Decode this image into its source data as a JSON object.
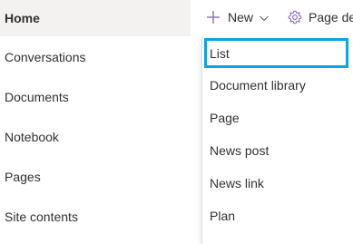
{
  "leftnav": {
    "items": [
      {
        "label": "Home"
      },
      {
        "label": "Conversations"
      },
      {
        "label": "Documents"
      },
      {
        "label": "Notebook"
      },
      {
        "label": "Pages"
      },
      {
        "label": "Site contents"
      }
    ]
  },
  "commandbar": {
    "new_label": "New",
    "page_details_label": "Page de",
    "icons": [
      "plus-icon",
      "chevron-down-icon",
      "gear-icon"
    ],
    "accent_color": "#8764b8"
  },
  "new_menu": {
    "items": [
      {
        "label": "List"
      },
      {
        "label": "Document library"
      },
      {
        "label": "Page"
      },
      {
        "label": "News post"
      },
      {
        "label": "News link"
      },
      {
        "label": "Plan"
      }
    ],
    "highlight_color": "#0aa4e8"
  }
}
